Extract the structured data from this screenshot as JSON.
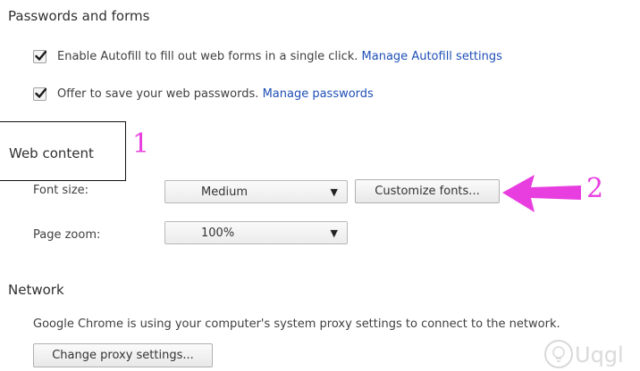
{
  "passwords": {
    "title": "Passwords and forms",
    "autofill": {
      "text": "Enable Autofill to fill out web forms in a single click.",
      "link": "Manage Autofill settings",
      "checked": true
    },
    "save_passwords": {
      "text": "Offer to save your web passwords.",
      "link": "Manage passwords",
      "checked": true
    }
  },
  "web_content": {
    "title": "Web content",
    "font_size": {
      "label": "Font size:",
      "value": "Medium"
    },
    "customize_fonts": "Customize fonts...",
    "page_zoom": {
      "label": "Page zoom:",
      "value": "100%"
    }
  },
  "network": {
    "title": "Network",
    "description": "Google Chrome is using your computer's system proxy settings to connect to the network.",
    "proxy_button": "Change proxy settings..."
  },
  "annotations": {
    "one": "1",
    "two": "2",
    "color": "#e83ee0"
  },
  "watermark": "Uqgl"
}
